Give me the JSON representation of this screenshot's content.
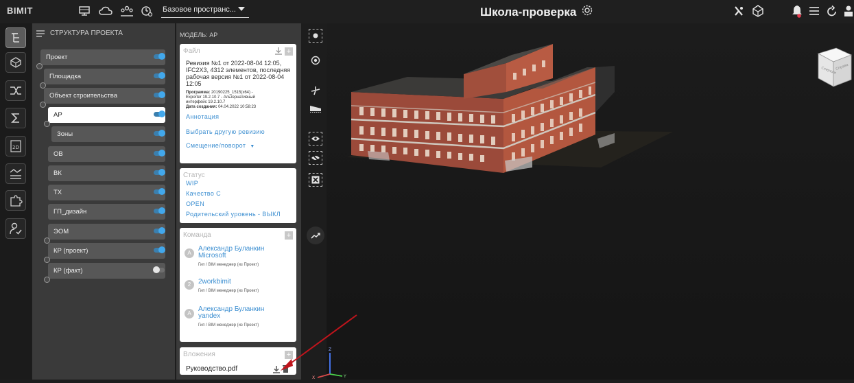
{
  "topbar": {
    "logo": "BIMIT",
    "space_select": "Базовое пространс...",
    "project_title": "Школа-проверка"
  },
  "structure": {
    "header": "СТРУКТУРА ПРОЕКТА",
    "nodes": [
      {
        "label": "Проект",
        "on": true
      },
      {
        "label": "Площадка",
        "on": true
      },
      {
        "label": "Объект строительства",
        "on": true
      },
      {
        "label": "АР",
        "on": true,
        "selected": true
      },
      {
        "label": "Зоны",
        "on": true
      },
      {
        "label": "ОВ",
        "on": true
      },
      {
        "label": "ВК",
        "on": true
      },
      {
        "label": "ТХ",
        "on": true
      },
      {
        "label": "ГП_дизайн",
        "on": true
      },
      {
        "label": "ЭОМ",
        "on": true
      },
      {
        "label": "КР (проект)",
        "on": true
      },
      {
        "label": "КР (факт)",
        "on": false
      }
    ]
  },
  "model": {
    "header": "МОДЕЛЬ: АР",
    "file": {
      "title": "Файл",
      "revision_line1": "Ревизия №1 от 2022-08-04 12:05,",
      "revision_line2": "IFC2X3, 4312 элементов, последняя",
      "revision_line3": "рабочая версия №1 от 2022-08-04",
      "revision_line4": "12:05",
      "program_label": "Программа:",
      "program_value": "20190225_1515(x64) -",
      "program_line2": "Exporter 19.2.10.7 - Альтернативный",
      "program_line3": "интерфейс 19.2.10.7",
      "created_label": "Дата создания:",
      "created_value": "04.04.2022 10:58:23",
      "annotation_link": "Аннотация",
      "choose_revision_link": "Выбрать другую ревизию",
      "offset_link": "Смещение/поворот"
    },
    "status": {
      "title": "Статус",
      "items": [
        "WIP",
        "Качество С",
        "OPEN",
        "Родительский уровень - ВЫКЛ"
      ]
    },
    "team": {
      "title": "Команда",
      "members": [
        {
          "avatar": "А",
          "name1": "Александр Буланкин",
          "name2": "Microsoft",
          "role": "Гип / BIM менеджер (из Проект)"
        },
        {
          "avatar": "2",
          "name1": "2workbimit",
          "name2": "",
          "role": "Гип / BIM менеджер (из Проект)"
        },
        {
          "avatar": "А",
          "name1": "Александр Буланкин",
          "name2": "yandex",
          "role": "Гип / BIM менеджер (из Проект)"
        }
      ]
    },
    "attachments": {
      "title": "Вложения",
      "file": "Руководство.pdf"
    }
  },
  "colors": {
    "accent_link": "#3d8fd1",
    "toggle_on": "#42a8ec",
    "annotation_arrow": "#c0141c"
  }
}
